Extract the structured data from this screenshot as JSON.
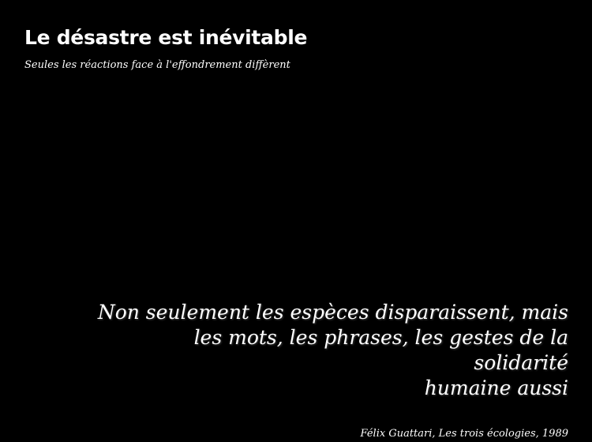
{
  "header": {
    "title": "Le désastre est inévitable",
    "subtitle": "Seules les réactions face à l'effondrement diffèrent"
  },
  "quote": {
    "lines": [
      "Non seulement les espèces disparaissent, mais",
      "les mots, les phrases, les gestes de la solidarité",
      "humaine aussi"
    ],
    "attribution": "Félix Guattari, Les trois écologies, 1989"
  },
  "colors": {
    "background": "#000000",
    "text": "#ffffff"
  }
}
